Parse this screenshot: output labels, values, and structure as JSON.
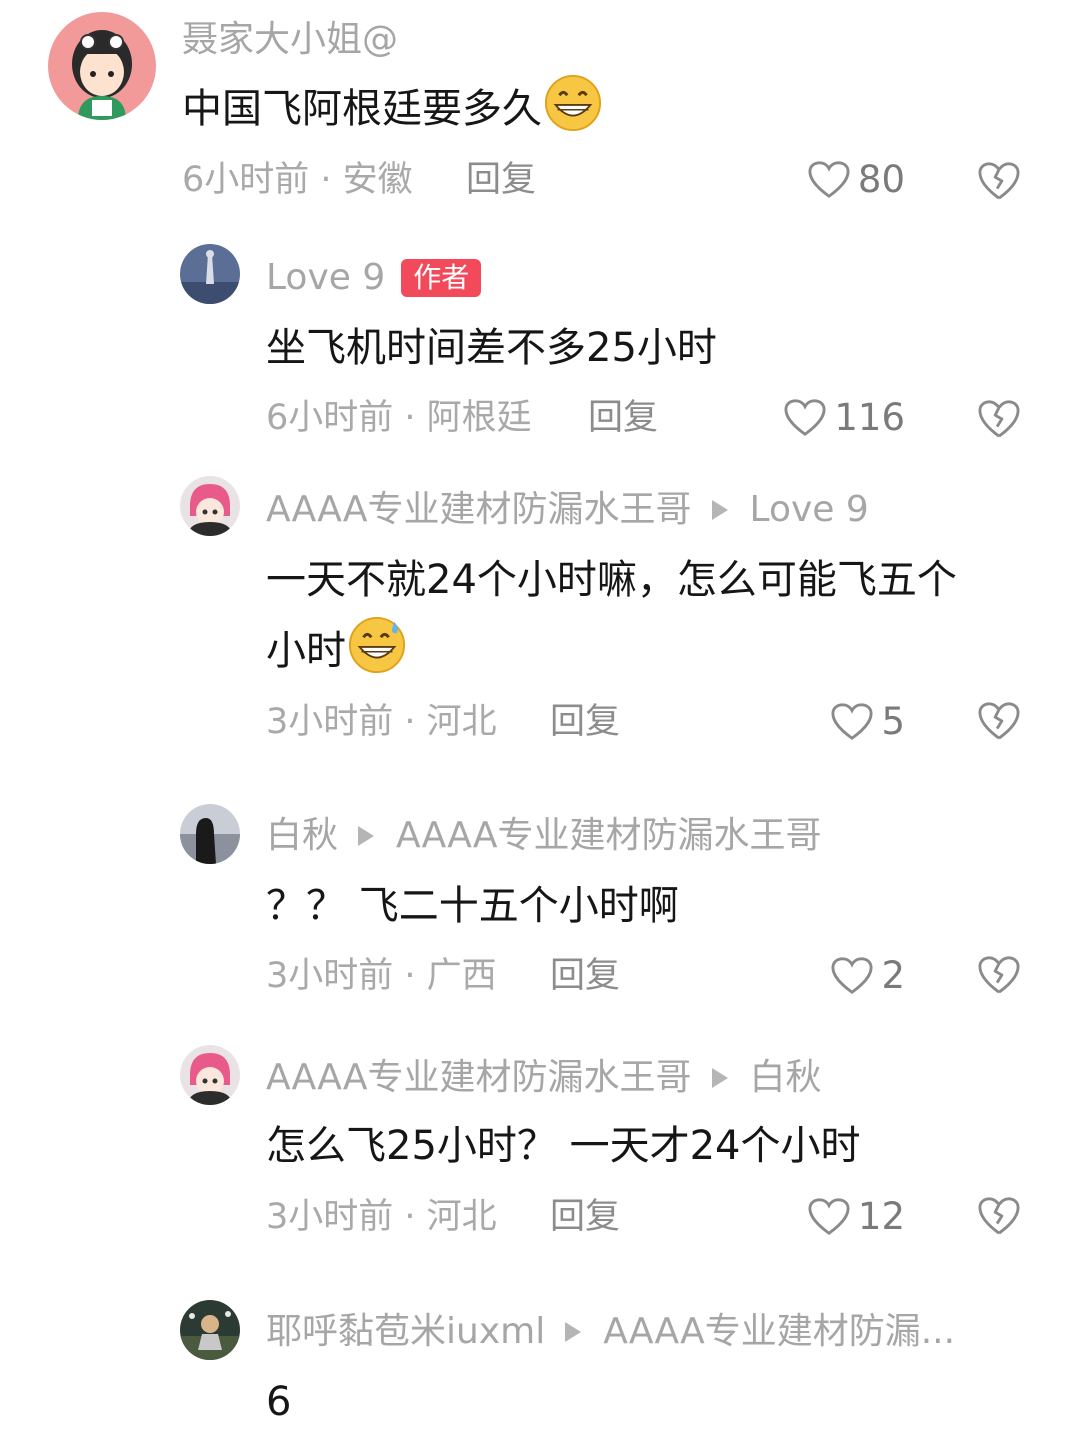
{
  "comments": [
    {
      "user": "聂家大小姐@",
      "text": "中国飞阿根廷要多久",
      "time_location": "6小时前 · 安徽",
      "reply_label": "回复",
      "likes": "80"
    },
    {
      "user": "Love 9",
      "badge": "作者",
      "text": "坐飞机时间差不多25小时",
      "time_location": "6小时前 · 阿根廷",
      "reply_label": "回复",
      "likes": "116"
    },
    {
      "user": "AAAA专业建材防漏水王哥",
      "reply_to": "Love 9",
      "text_line1": "一天不就24个小时嘛，怎么可能飞五个",
      "text_line2": "小时",
      "time_location": "3小时前 · 河北",
      "reply_label": "回复",
      "likes": "5"
    },
    {
      "user": "白秋",
      "reply_to": "AAAA专业建材防漏水王哥",
      "text": "？？ 飞二十五个小时啊",
      "time_location": "3小时前 · 广西",
      "reply_label": "回复",
      "likes": "2"
    },
    {
      "user": "AAAA专业建材防漏水王哥",
      "reply_to": "白秋",
      "text": "怎么飞25小时？ 一天才24个小时",
      "time_location": "3小时前 · 河北",
      "reply_label": "回复",
      "likes": "12"
    },
    {
      "user": "耶呼黏苞米iuxml",
      "reply_to": "AAAA专业建材防漏...",
      "text": "6"
    }
  ],
  "icons": {
    "like": "heart-outline-icon",
    "dislike": "broken-heart-icon",
    "reply_arrow": "triangle-right-icon",
    "emoji_grin": "grinning-face-emoji",
    "emoji_sweat": "grinning-sweat-emoji"
  },
  "colors": {
    "author_badge": "#f24a5a",
    "username": "#a6a6a6",
    "text": "#161616",
    "meta": "#a9a9a9"
  }
}
